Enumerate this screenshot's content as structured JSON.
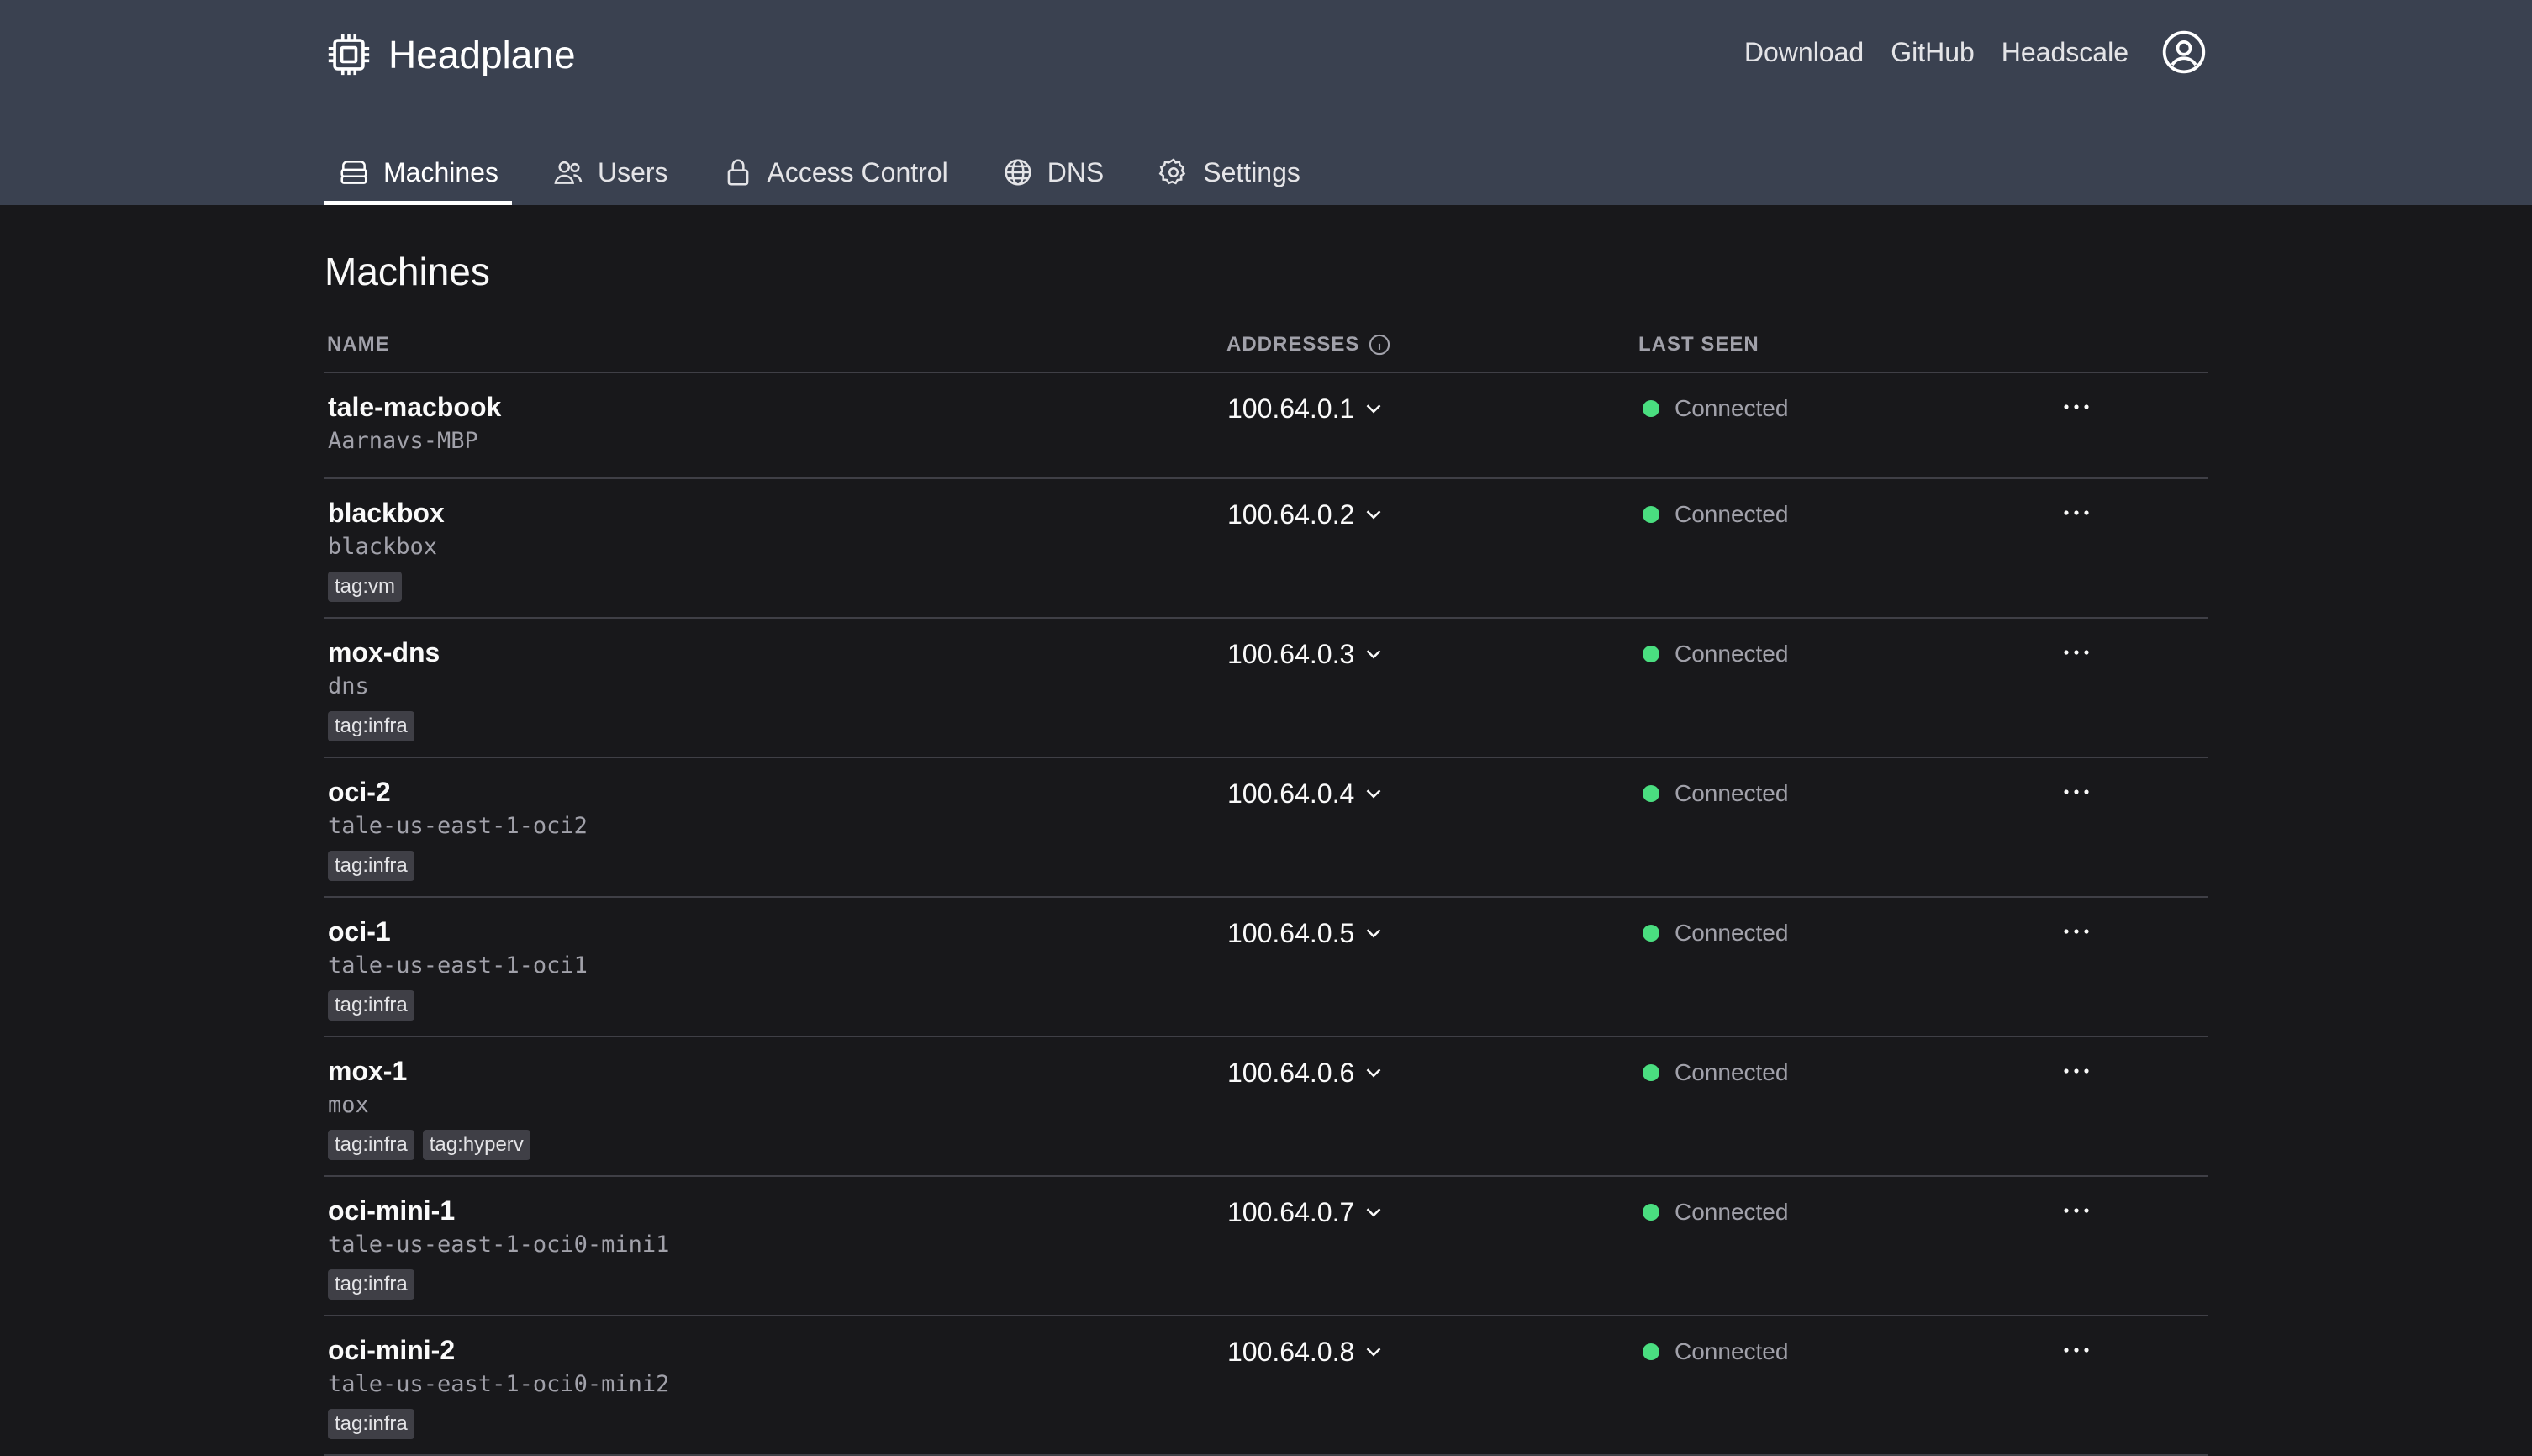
{
  "app": {
    "title": "Headplane"
  },
  "top_links": [
    {
      "label": "Download"
    },
    {
      "label": "GitHub"
    },
    {
      "label": "Headscale"
    }
  ],
  "tabs": [
    {
      "label": "Machines",
      "icon": "server-icon",
      "active": true
    },
    {
      "label": "Users",
      "icon": "users-icon",
      "active": false
    },
    {
      "label": "Access Control",
      "icon": "lock-icon",
      "active": false
    },
    {
      "label": "DNS",
      "icon": "globe-icon",
      "active": false
    },
    {
      "label": "Settings",
      "icon": "gear-icon",
      "active": false
    }
  ],
  "page": {
    "title": "Machines"
  },
  "table": {
    "columns": {
      "name": "NAME",
      "addresses": "ADDRESSES",
      "last_seen": "LAST SEEN"
    },
    "status_color": "#4ade80",
    "rows": [
      {
        "name": "tale-macbook",
        "host": "Aarnavs-MBP",
        "tags": [],
        "address": "100.64.0.1",
        "status": "Connected"
      },
      {
        "name": "blackbox",
        "host": "blackbox",
        "tags": [
          "tag:vm"
        ],
        "address": "100.64.0.2",
        "status": "Connected"
      },
      {
        "name": "mox-dns",
        "host": "dns",
        "tags": [
          "tag:infra"
        ],
        "address": "100.64.0.3",
        "status": "Connected"
      },
      {
        "name": "oci-2",
        "host": "tale-us-east-1-oci2",
        "tags": [
          "tag:infra"
        ],
        "address": "100.64.0.4",
        "status": "Connected"
      },
      {
        "name": "oci-1",
        "host": "tale-us-east-1-oci1",
        "tags": [
          "tag:infra"
        ],
        "address": "100.64.0.5",
        "status": "Connected"
      },
      {
        "name": "mox-1",
        "host": "mox",
        "tags": [
          "tag:infra",
          "tag:hyperv"
        ],
        "address": "100.64.0.6",
        "status": "Connected"
      },
      {
        "name": "oci-mini-1",
        "host": "tale-us-east-1-oci0-mini1",
        "tags": [
          "tag:infra"
        ],
        "address": "100.64.0.7",
        "status": "Connected"
      },
      {
        "name": "oci-mini-2",
        "host": "tale-us-east-1-oci0-mini2",
        "tags": [
          "tag:infra"
        ],
        "address": "100.64.0.8",
        "status": "Connected"
      }
    ]
  }
}
